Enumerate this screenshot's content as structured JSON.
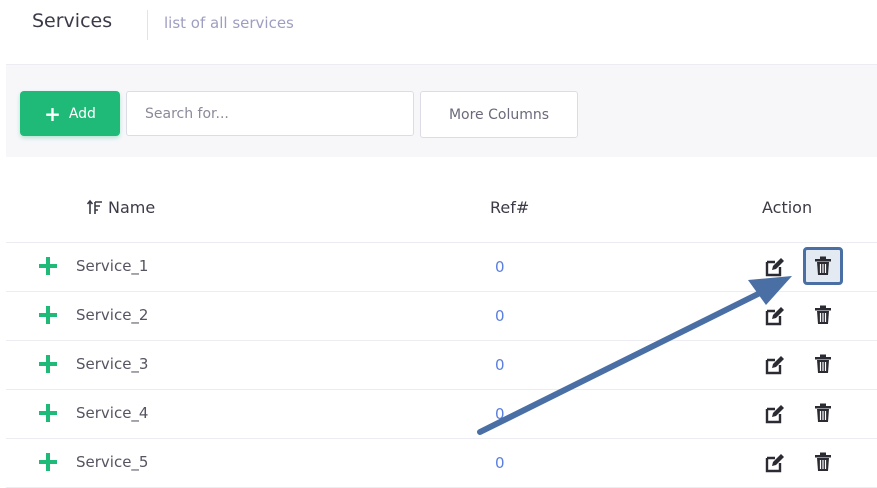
{
  "header": {
    "title": "Services",
    "subtitle": "list of all services"
  },
  "toolbar": {
    "add_label": "Add",
    "search_placeholder": "Search for...",
    "more_columns_label": "More Columns"
  },
  "table": {
    "columns": [
      "Name",
      "Ref#",
      "Action"
    ],
    "rows": [
      {
        "name": "Service_1",
        "ref": "0"
      },
      {
        "name": "Service_2",
        "ref": "0"
      },
      {
        "name": "Service_3",
        "ref": "0"
      },
      {
        "name": "Service_4",
        "ref": "0"
      },
      {
        "name": "Service_5",
        "ref": "0"
      }
    ]
  },
  "colors": {
    "accent_green": "#1fb978",
    "link_blue": "#5b7fe0",
    "annotation_blue": "#4a6fa5"
  },
  "icons": {
    "sort": "sort-icon",
    "expand": "plus-icon",
    "edit": "edit-icon",
    "delete": "trash-icon"
  }
}
